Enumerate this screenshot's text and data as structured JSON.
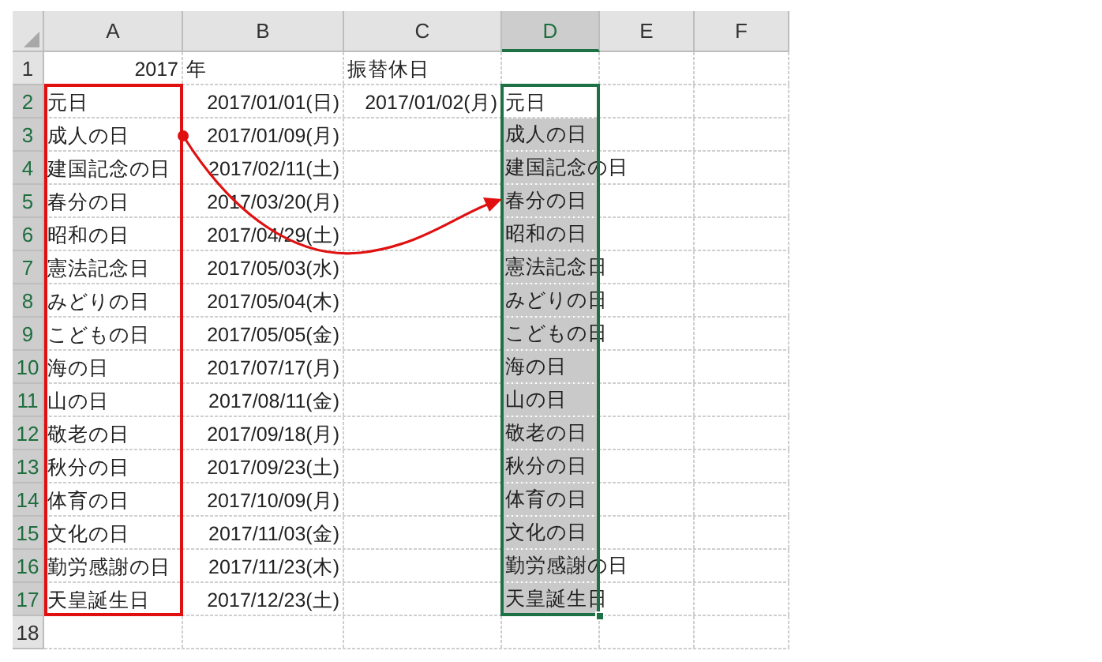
{
  "sheet": {
    "columns": [
      {
        "label": "A",
        "selected": false
      },
      {
        "label": "B",
        "selected": false
      },
      {
        "label": "C",
        "selected": false
      },
      {
        "label": "D",
        "selected": true
      },
      {
        "label": "E",
        "selected": false
      },
      {
        "label": "F",
        "selected": false
      }
    ],
    "rows": [
      {
        "number": "1",
        "selected": false,
        "cells": [
          {
            "text": "2017",
            "kind": "number"
          },
          {
            "text": "年",
            "kind": "text"
          },
          {
            "text": "振替休日",
            "kind": "text"
          }
        ]
      },
      {
        "number": "2",
        "selected": true,
        "cells": [
          {
            "text": "元日",
            "kind": "text"
          },
          {
            "text": "2017/01/01(日)",
            "kind": "number"
          },
          {
            "text": "2017/01/02(月)",
            "kind": "number"
          },
          {
            "text": "元日",
            "kind": "text"
          }
        ]
      },
      {
        "number": "3",
        "selected": true,
        "cells": [
          {
            "text": "成人の日",
            "kind": "text"
          },
          {
            "text": "2017/01/09(月)",
            "kind": "number"
          },
          {
            "text": "",
            "kind": "text"
          },
          {
            "text": "成人の日",
            "kind": "text"
          }
        ]
      },
      {
        "number": "4",
        "selected": true,
        "cells": [
          {
            "text": "建国記念の日",
            "kind": "text"
          },
          {
            "text": "2017/02/11(土)",
            "kind": "number"
          },
          {
            "text": "",
            "kind": "text"
          },
          {
            "text": "建国記念の日",
            "kind": "text"
          }
        ]
      },
      {
        "number": "5",
        "selected": true,
        "cells": [
          {
            "text": "春分の日",
            "kind": "text"
          },
          {
            "text": "2017/03/20(月)",
            "kind": "number"
          },
          {
            "text": "",
            "kind": "text"
          },
          {
            "text": "春分の日",
            "kind": "text"
          }
        ]
      },
      {
        "number": "6",
        "selected": true,
        "cells": [
          {
            "text": "昭和の日",
            "kind": "text"
          },
          {
            "text": "2017/04/29(土)",
            "kind": "number"
          },
          {
            "text": "",
            "kind": "text"
          },
          {
            "text": "昭和の日",
            "kind": "text"
          }
        ]
      },
      {
        "number": "7",
        "selected": true,
        "cells": [
          {
            "text": "憲法記念日",
            "kind": "text"
          },
          {
            "text": "2017/05/03(水)",
            "kind": "number"
          },
          {
            "text": "",
            "kind": "text"
          },
          {
            "text": "憲法記念日",
            "kind": "text"
          }
        ]
      },
      {
        "number": "8",
        "selected": true,
        "cells": [
          {
            "text": "みどりの日",
            "kind": "text"
          },
          {
            "text": "2017/05/04(木)",
            "kind": "number"
          },
          {
            "text": "",
            "kind": "text"
          },
          {
            "text": "みどりの日",
            "kind": "text"
          }
        ]
      },
      {
        "number": "9",
        "selected": true,
        "cells": [
          {
            "text": "こどもの日",
            "kind": "text"
          },
          {
            "text": "2017/05/05(金)",
            "kind": "number"
          },
          {
            "text": "",
            "kind": "text"
          },
          {
            "text": "こどもの日",
            "kind": "text"
          }
        ]
      },
      {
        "number": "10",
        "selected": true,
        "cells": [
          {
            "text": "海の日",
            "kind": "text"
          },
          {
            "text": "2017/07/17(月)",
            "kind": "number"
          },
          {
            "text": "",
            "kind": "text"
          },
          {
            "text": "海の日",
            "kind": "text"
          }
        ]
      },
      {
        "number": "11",
        "selected": true,
        "cells": [
          {
            "text": "山の日",
            "kind": "text"
          },
          {
            "text": "2017/08/11(金)",
            "kind": "number"
          },
          {
            "text": "",
            "kind": "text"
          },
          {
            "text": "山の日",
            "kind": "text"
          }
        ]
      },
      {
        "number": "12",
        "selected": true,
        "cells": [
          {
            "text": "敬老の日",
            "kind": "text"
          },
          {
            "text": "2017/09/18(月)",
            "kind": "number"
          },
          {
            "text": "",
            "kind": "text"
          },
          {
            "text": "敬老の日",
            "kind": "text"
          }
        ]
      },
      {
        "number": "13",
        "selected": true,
        "cells": [
          {
            "text": "秋分の日",
            "kind": "text"
          },
          {
            "text": "2017/09/23(土)",
            "kind": "number"
          },
          {
            "text": "",
            "kind": "text"
          },
          {
            "text": "秋分の日",
            "kind": "text"
          }
        ]
      },
      {
        "number": "14",
        "selected": true,
        "cells": [
          {
            "text": "体育の日",
            "kind": "text"
          },
          {
            "text": "2017/10/09(月)",
            "kind": "number"
          },
          {
            "text": "",
            "kind": "text"
          },
          {
            "text": "体育の日",
            "kind": "text"
          }
        ]
      },
      {
        "number": "15",
        "selected": true,
        "cells": [
          {
            "text": "文化の日",
            "kind": "text"
          },
          {
            "text": "2017/11/03(金)",
            "kind": "number"
          },
          {
            "text": "",
            "kind": "text"
          },
          {
            "text": "文化の日",
            "kind": "text"
          }
        ]
      },
      {
        "number": "16",
        "selected": true,
        "cells": [
          {
            "text": "勤労感謝の日",
            "kind": "text"
          },
          {
            "text": "2017/11/23(木)",
            "kind": "number"
          },
          {
            "text": "",
            "kind": "text"
          },
          {
            "text": "勤労感謝の日",
            "kind": "text"
          }
        ]
      },
      {
        "number": "17",
        "selected": true,
        "cells": [
          {
            "text": "天皇誕生日",
            "kind": "text"
          },
          {
            "text": "2017/12/23(土)",
            "kind": "number"
          },
          {
            "text": "",
            "kind": "text"
          },
          {
            "text": "天皇誕生日",
            "kind": "text"
          }
        ]
      },
      {
        "number": "18",
        "selected": false,
        "cells": []
      }
    ]
  }
}
